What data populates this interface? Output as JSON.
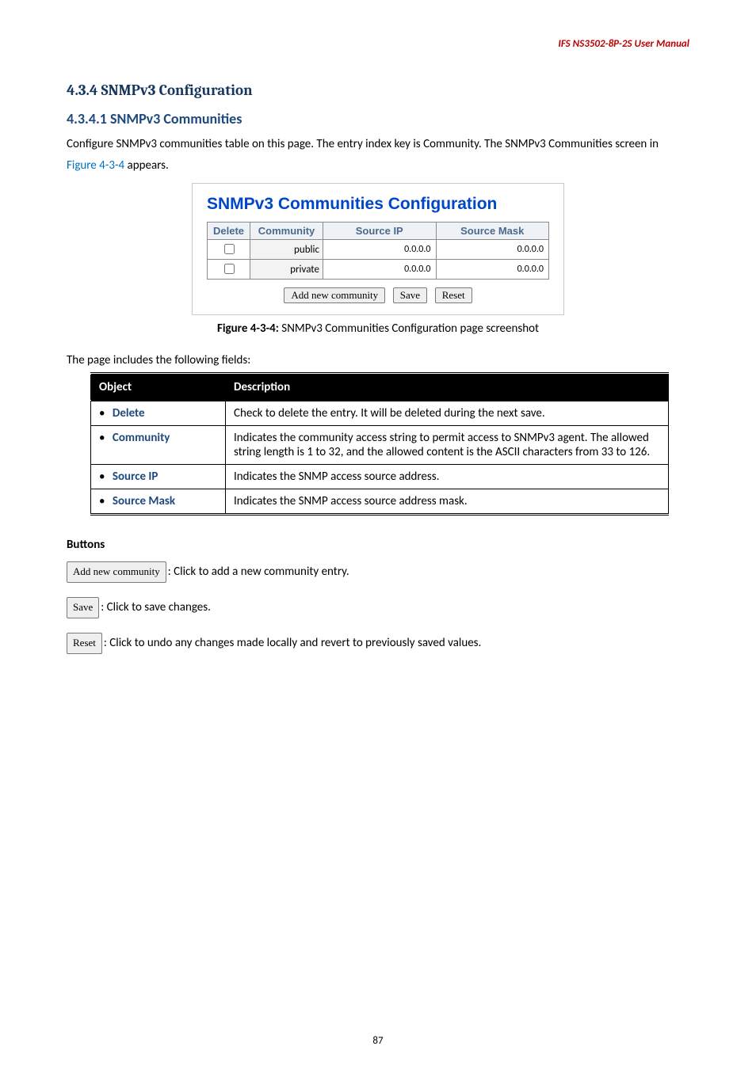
{
  "header": "IFS  NS3502-8P-2S  User  Manual",
  "heading3": "4.3.4 SNMPv3 Configuration",
  "heading4": "4.3.4.1 SNMPv3 Communities",
  "intro_part1": "Configure SNMPv3 communities table on this page. The entry index key is Community. The SNMPv3 Communities screen in ",
  "intro_link": "Figure 4-3-4",
  "intro_part2": " appears.",
  "config": {
    "title": "SNMPv3 Communities Configuration",
    "headers": {
      "del": "Delete",
      "comm": "Community",
      "sip": "Source IP",
      "smask": "Source Mask"
    },
    "rows": [
      {
        "community": "public",
        "source_ip": "0.0.0.0",
        "source_mask": "0.0.0.0"
      },
      {
        "community": "private",
        "source_ip": "0.0.0.0",
        "source_mask": "0.0.0.0"
      }
    ],
    "buttons": {
      "add": "Add new community",
      "save": "Save",
      "reset": "Reset"
    }
  },
  "figcap_bold": "Figure 4-3-4:",
  "figcap_rest": " SNMPv3 Communities Configuration page screenshot",
  "fields_intro": "The page includes the following fields:",
  "fields_table": {
    "head_obj": "Object",
    "head_desc": "Description",
    "rows": [
      {
        "label": "Delete",
        "desc": "Check to delete the entry. It will be deleted during the next save."
      },
      {
        "label": "Community",
        "desc": "Indicates the community access string to permit access to SNMPv3 agent. The allowed string length is 1 to 32, and the allowed content is the ASCII characters from 33 to 126."
      },
      {
        "label": "Source IP",
        "desc": "Indicates the SNMP access source address."
      },
      {
        "label": "Source Mask",
        "desc": "Indicates the SNMP access source address mask."
      }
    ]
  },
  "buttons_section": {
    "title": "Buttons",
    "add_text": ": Click to add a new community entry.",
    "save_text": ": Click to save changes.",
    "reset_text": ": Click to undo any changes made locally and revert to previously saved values."
  },
  "pagenum": "87"
}
